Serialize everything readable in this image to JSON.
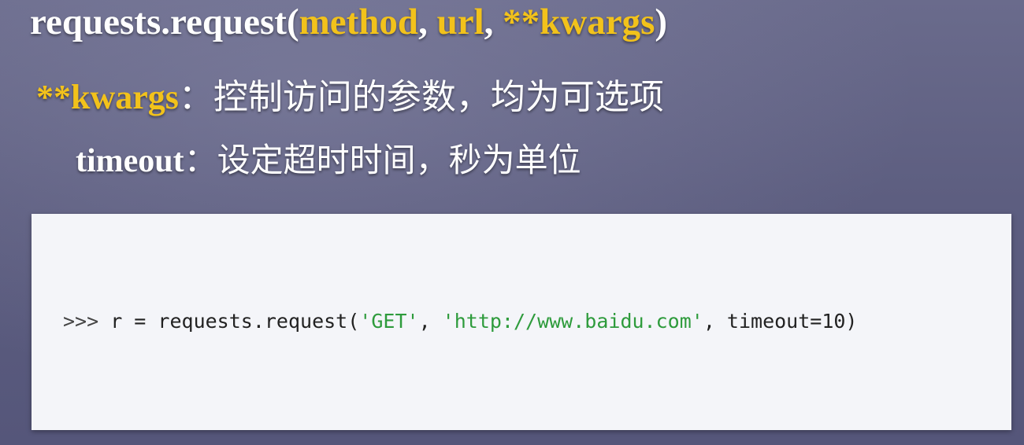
{
  "slide": {
    "title": {
      "func": "requests.request(",
      "arg1": "method",
      "sep1": ", ",
      "arg2": "url",
      "sep2": ", ",
      "arg3": "**kwargs",
      "close": ")"
    },
    "kwargs_line": {
      "key": "**kwargs",
      "colon": "：",
      "desc": "控制访问的参数，均为可选项"
    },
    "param_line": {
      "key": "timeout",
      "colon": "：",
      "desc": "设定超时时间，秒为单位"
    },
    "code": {
      "prompt": ">>>",
      "before": " r = requests.request(",
      "str1": "'GET'",
      "mid": ", ",
      "str2": "'http://www.baidu.com'",
      "after": ", timeout=10)"
    }
  },
  "colors": {
    "highlight": "#f2c21b",
    "string_green": "#2e9b3c",
    "background": "#5d5e80",
    "code_background": "#f4f5f9"
  }
}
